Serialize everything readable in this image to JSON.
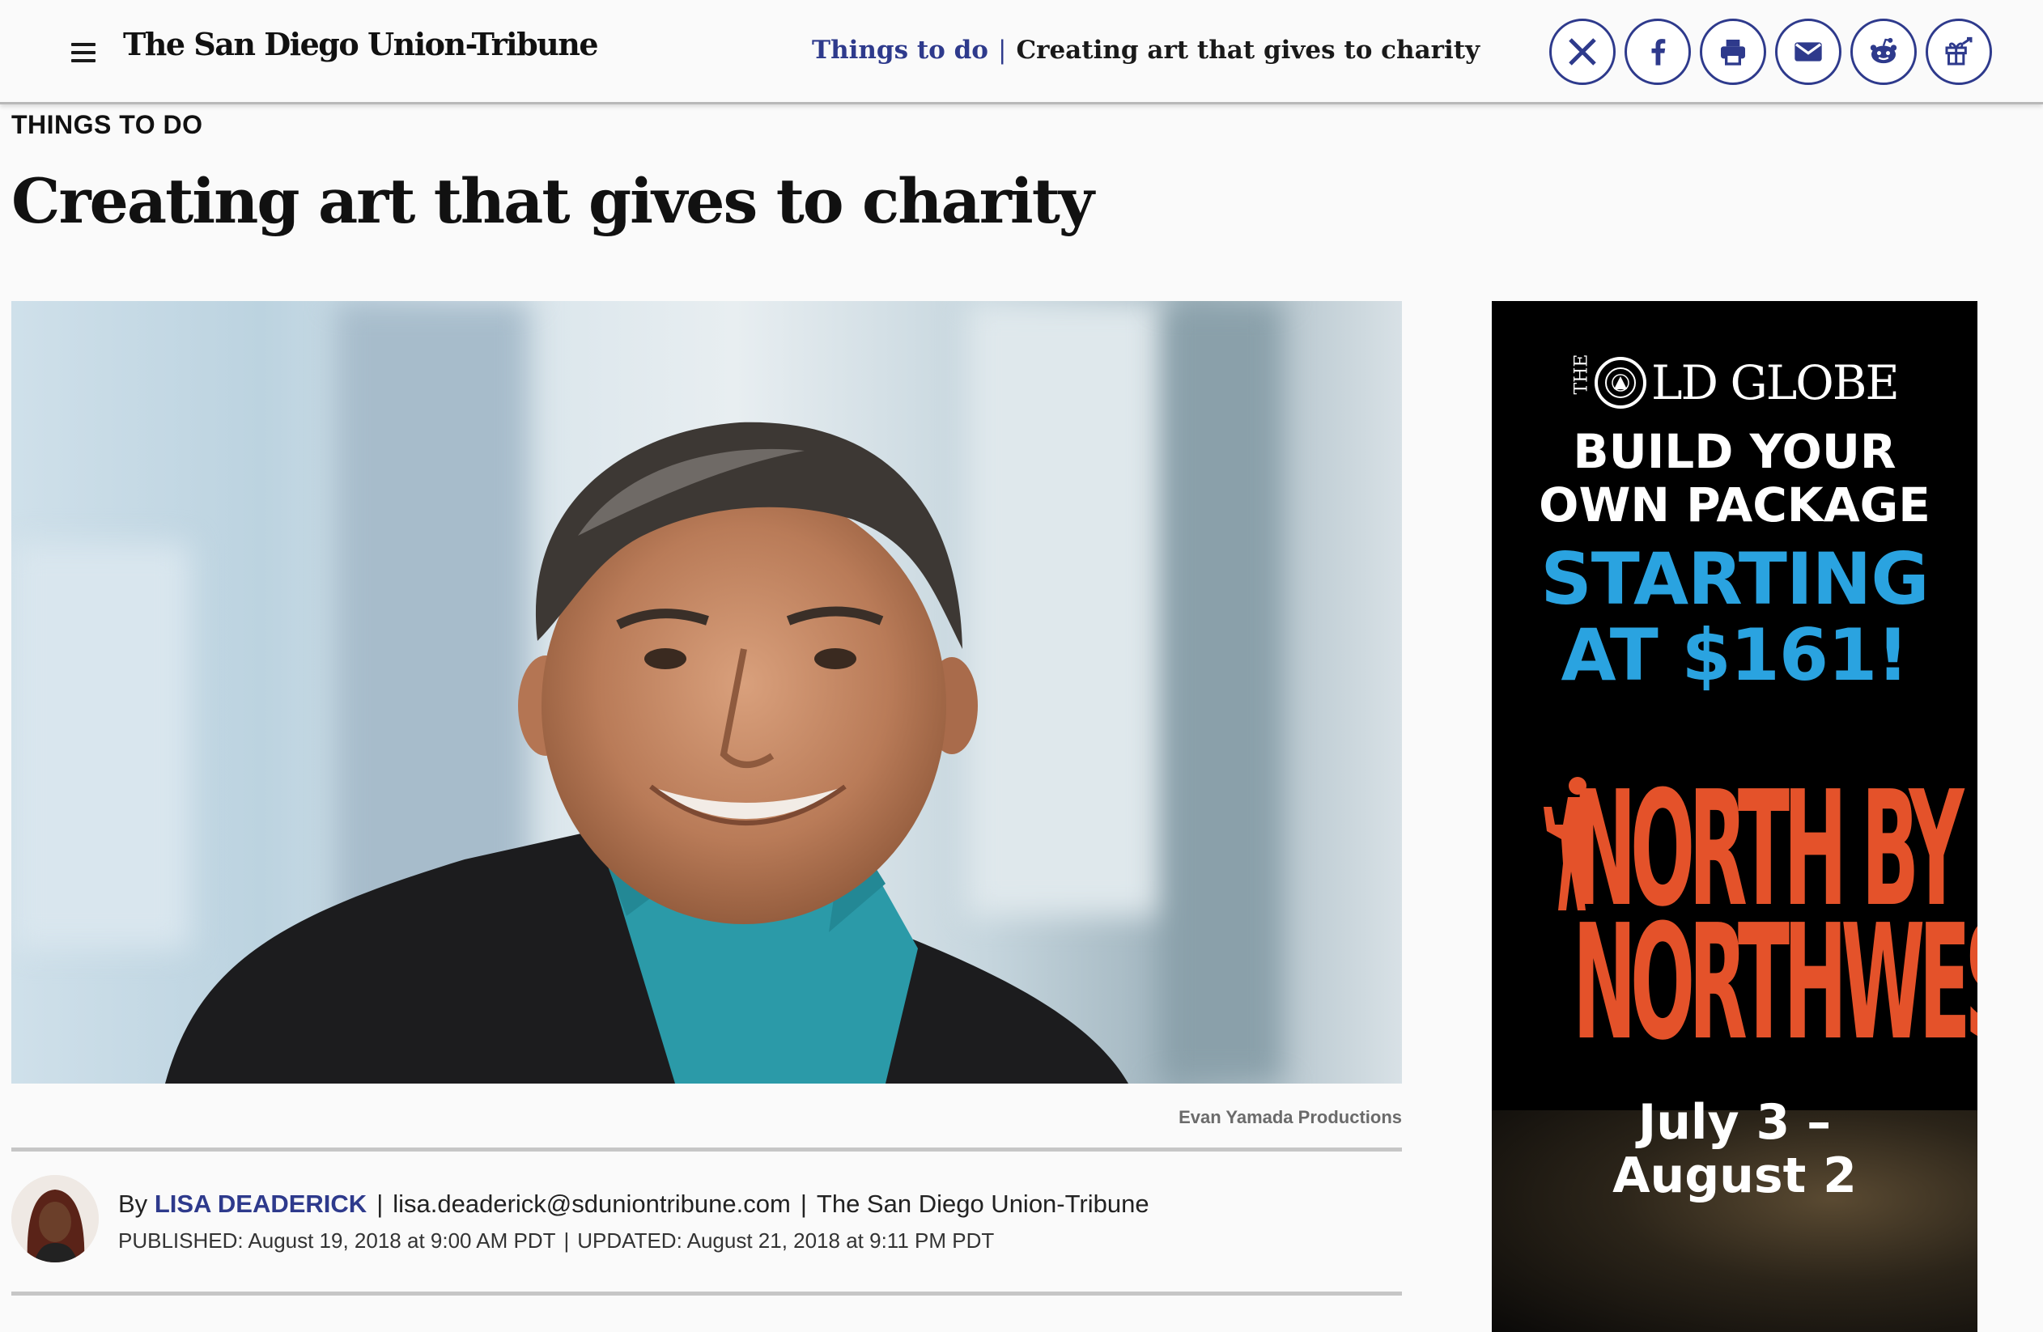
{
  "header": {
    "masthead": "The San Diego Union-Tribune",
    "breadcrumb_section": "Things to do",
    "breadcrumb_separator": "|",
    "breadcrumb_title": "Creating art that gives to charity",
    "share_icons": [
      "x-icon",
      "facebook-icon",
      "print-icon",
      "email-icon",
      "reddit-icon",
      "gift-icon"
    ],
    "accent_color": "#2e3a8c"
  },
  "article": {
    "kicker": "THINGS TO DO",
    "headline": "Creating art that gives to charity",
    "photo_credit": "Evan Yamada Productions",
    "byline": {
      "by": "By",
      "author": "LISA DEADERICK",
      "email": "lisa.deaderick@sduniontribune.com",
      "publication": "The San Diego Union-Tribune",
      "separator": "|"
    },
    "published": "PUBLISHED: August 19, 2018 at 9:00 AM PDT",
    "updated": "UPDATED: August 21, 2018 at 9:11 PM PDT"
  },
  "ad": {
    "brand_the": "THE",
    "brand_name": "LD GLOBE",
    "line1": "BUILD YOUR",
    "line2": "OWN PACKAGE",
    "line3": "STARTING",
    "line4": "AT $161!",
    "show_line1": "NORTH BY",
    "show_line2": "NORTHWEST",
    "date_line1": "July 3 –",
    "date_line2": "August 2",
    "colors": {
      "blue": "#2aa3e0",
      "orange": "#e4522a"
    }
  }
}
